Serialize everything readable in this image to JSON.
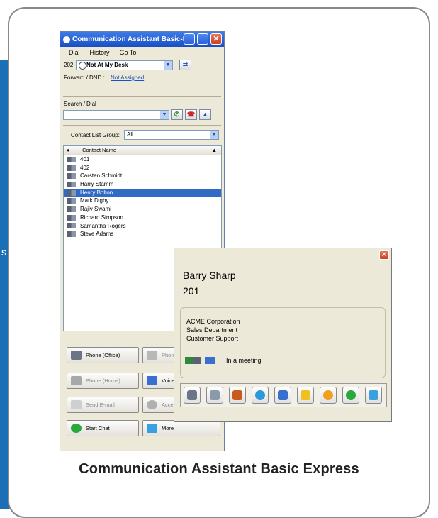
{
  "caption": "Communication Assistant Basic Express",
  "window": {
    "title": "Communication Assistant Basic-E...",
    "menu": [
      "Dial",
      "History",
      "Go To"
    ],
    "extension": "202",
    "status": "Not At My Desk",
    "forward_label": "Forward / DND :",
    "forward_value": "Not Assigned",
    "search_label": "Search / Dial",
    "contact_group_label": "Contact List Group:",
    "contact_group_value": "All",
    "list_header": "Contact Name",
    "contacts": [
      "401",
      "402",
      "Carsten Schmidt",
      "Harry Stamm",
      "Henry Bolton",
      "Mark Digby",
      "Rajiv Swami",
      "Richard Simpson",
      "Samantha Rogers",
      "Steve Adams"
    ],
    "selected_contact": "Henry Bolton",
    "buttons": {
      "phone_office": "Phone (Office)",
      "phone_mobile": "Phone",
      "phone_home": "Phone (Home)",
      "voice": "Voice",
      "send_email": "Send E-mail",
      "access": "Acce",
      "start_chat": "Start Chat",
      "more": "More"
    }
  },
  "popup": {
    "name": "Barry Sharp",
    "extension": "201",
    "company": "ACME Corporation",
    "department": "Sales Department",
    "role": "Customer Support",
    "presence": "In a meeting",
    "actions": [
      "phone-office-icon",
      "phone-mobile-icon",
      "phone-home-icon",
      "contact-icon",
      "voicemail-icon",
      "email-icon",
      "access-icon",
      "chat-icon",
      "more-icon"
    ]
  },
  "colors": {
    "accent_blue": "#1b6fb6",
    "title_blue": "#1a4fc4",
    "selection": "#316ac5",
    "close_red": "#c8401f"
  }
}
